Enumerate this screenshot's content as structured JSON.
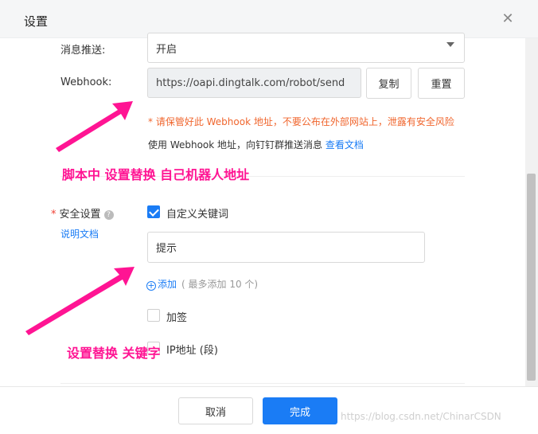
{
  "dialog": {
    "title": "设置",
    "close_glyph": "✕"
  },
  "push": {
    "label": "消息推送:",
    "value": "开启"
  },
  "webhook": {
    "label": "Webhook:",
    "value": "https://oapi.dingtalk.com/robot/send",
    "copy_label": "复制",
    "reset_label": "重置",
    "warning": "* 请保管好此 Webhook 地址，不要公布在外部网站上，泄露有安全风险",
    "hint": "使用 Webhook 地址，向钉钉群推送消息",
    "hint_link": "查看文档"
  },
  "security": {
    "required_mark": "*",
    "label": "安全设置",
    "help_glyph": "?",
    "doc_link": "说明文档",
    "keyword_label": "自定义关键词",
    "keyword_checked": true,
    "keyword_value": "提示",
    "add_glyph": "+",
    "add_label": "添加",
    "add_note": "( 最多添加 10 个)",
    "sign_label": "加签",
    "sign_checked": false,
    "ip_label": "IP地址 (段)",
    "ip_checked": false
  },
  "annotations": {
    "webhook_note": "脚本中 设置替换 自己机器人地址",
    "keyword_note": "设置替换 关键字",
    "color": "#ff1493"
  },
  "footer": {
    "cancel_label": "取消",
    "done_label": "完成"
  },
  "watermark": "https://blog.csdn.net/ChinarCSDN",
  "colors": {
    "primary": "#1a7cf5",
    "warning": "#f0662e"
  }
}
